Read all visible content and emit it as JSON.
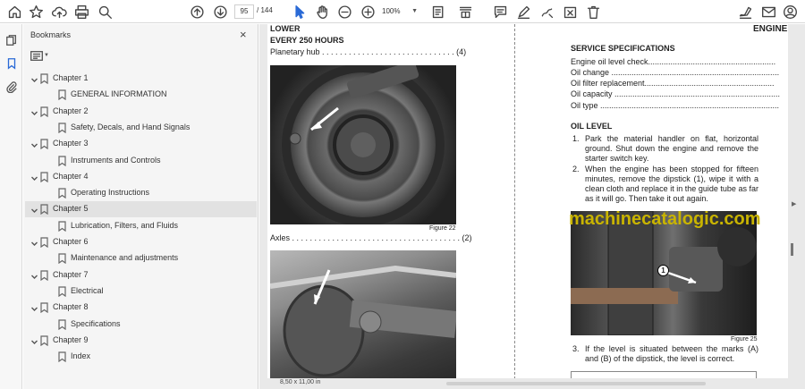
{
  "toolbar": {
    "page_current": "95",
    "page_total": "/ 144",
    "zoom": "100%"
  },
  "panel": {
    "title": "Bookmarks",
    "close": "×"
  },
  "bookmarks": [
    {
      "label": "Chapter 1",
      "level": 0
    },
    {
      "label": "GENERAL INFORMATION",
      "level": 1
    },
    {
      "label": "Chapter 2",
      "level": 0
    },
    {
      "label": "Safety, Decals, and Hand Signals",
      "level": 1
    },
    {
      "label": "Chapter 3",
      "level": 0
    },
    {
      "label": "Instruments and Controls",
      "level": 1
    },
    {
      "label": "Chapter 4",
      "level": 0
    },
    {
      "label": "Operating Instructions",
      "level": 1
    },
    {
      "label": "Chapter 5",
      "level": 0,
      "selected": true
    },
    {
      "label": "Lubrication, Filters, and Fluids",
      "level": 1
    },
    {
      "label": "Chapter 6",
      "level": 0
    },
    {
      "label": "Maintenance and adjustments",
      "level": 1
    },
    {
      "label": "Chapter 7",
      "level": 0
    },
    {
      "label": "Electrical",
      "level": 1
    },
    {
      "label": "Chapter 8",
      "level": 0
    },
    {
      "label": "Specifications",
      "level": 1
    },
    {
      "label": "Chapter 9",
      "level": 0
    },
    {
      "label": "Index",
      "level": 1
    }
  ],
  "doc": {
    "left": {
      "heading1": "LOWER",
      "heading2": "EVERY 250 HOURS",
      "item1": "Planetary hub . . . . . . . . . . . . . . . . . . . . . . . . . . . . . . (4)",
      "figure1": "Figure 22",
      "item2": "Axles . . . . . . . . . . . . . . . . . . . . . . . . . . . . . . . . . . . . . . (2)"
    },
    "right": {
      "engine_heading": "ENGINE",
      "service_heading": "SERVICE SPECIFICATIONS",
      "service_rows": [
        "Engine oil level check.........................................................",
        "Oil change ...........................................................................",
        "Oil filter replacement..........................................................",
        "Oil capacity ..........................................................................",
        "Oil type ................................................................................"
      ],
      "oil_level_heading": "OIL LEVEL",
      "steps": [
        {
          "n": "1.",
          "text": "Park the material handler on flat, horizontal ground. Shut down the engine and remove the starter switch key."
        },
        {
          "n": "2.",
          "text": "When the engine has been stopped for fifteen minutes, remove the dipstick (1), wipe it with a clean cloth and replace it in the guide tube as far as it will go. Then take it out again."
        },
        {
          "n": "3.",
          "text": "If the level is situated between the marks (A) and (B) of the dipstick, the level is correct."
        }
      ],
      "callout": "1",
      "figure25": "Figure 25"
    },
    "watermark": "machinecatalogic.com"
  },
  "status": {
    "page_size": "8,50 x 11,00 in"
  },
  "colors": {
    "watermark": "#c9b400",
    "selected_bookmark": "#e2e2e2"
  }
}
